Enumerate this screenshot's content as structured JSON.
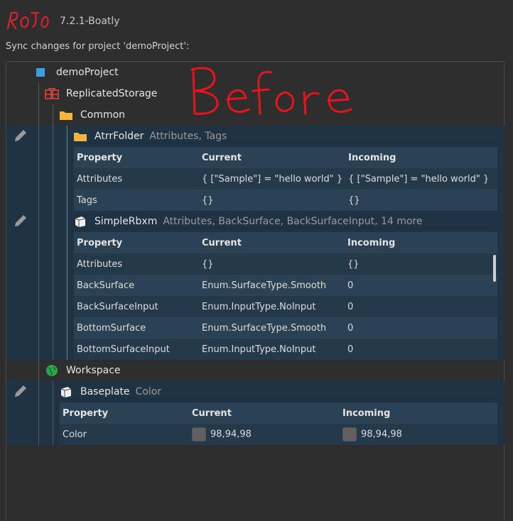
{
  "header": {
    "app_name": "Rojo",
    "version": "7.2.1-Boatly",
    "subtitle": "Sync changes for project 'demoProject':"
  },
  "annotation": "Before",
  "tree": {
    "root": "demoProject",
    "replicated_storage": "ReplicatedStorage",
    "common": "Common",
    "atrr_folder": {
      "name": "AtrrFolder",
      "extra": "Attributes, Tags"
    },
    "simple_rbxm": {
      "name": "SimpleRbxm",
      "extra": "Attributes, BackSurface, BackSurfaceInput, 14 more"
    },
    "workspace": "Workspace",
    "baseplate": {
      "name": "Baseplate",
      "extra": "Color"
    }
  },
  "table_headers": {
    "property": "Property",
    "current": "Current",
    "incoming": "Incoming"
  },
  "atrr_table": [
    {
      "property": "Attributes",
      "current": "{ [\"Sample\"] = \"hello world\" }",
      "incoming": "{ [\"Sample\"] = \"hello world\" }"
    },
    {
      "property": "Tags",
      "current": "{}",
      "incoming": "{}"
    }
  ],
  "rbxm_table": [
    {
      "property": "Attributes",
      "current": "{}",
      "incoming": "{}"
    },
    {
      "property": "BackSurface",
      "current": "Enum.SurfaceType.Smooth",
      "incoming": "0"
    },
    {
      "property": "BackSurfaceInput",
      "current": "Enum.InputType.NoInput",
      "incoming": "0"
    },
    {
      "property": "BottomSurface",
      "current": "Enum.SurfaceType.Smooth",
      "incoming": "0"
    },
    {
      "property": "BottomSurfaceInput",
      "current": "Enum.InputType.NoInput",
      "incoming": "0"
    }
  ],
  "baseplate_table": [
    {
      "property": "Color",
      "current": "98,94,98",
      "incoming": "98,94,98",
      "swatch_color": "#625e62"
    }
  ],
  "colors": {
    "changed_bg": "#1f3344",
    "row_alt": "#2a4253",
    "accent_blue": "#3aa0e0",
    "annotation_red": "#e8141c"
  }
}
